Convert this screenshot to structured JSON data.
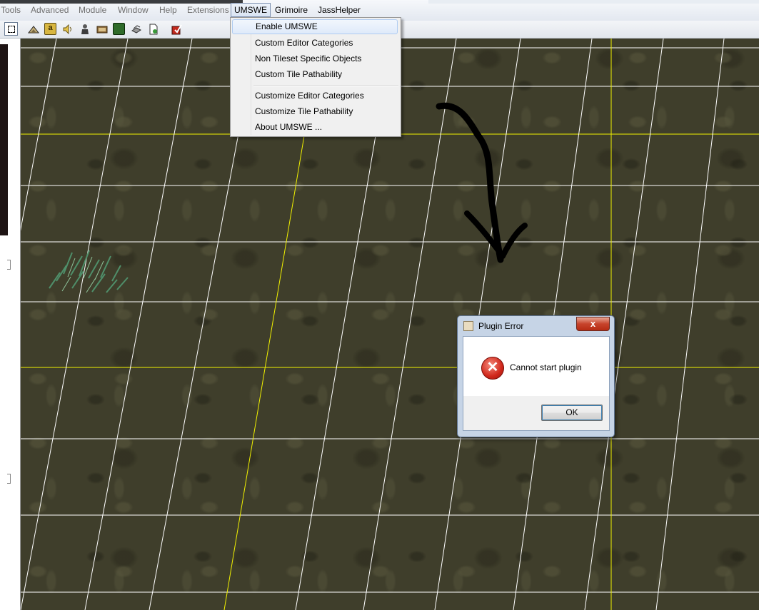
{
  "menubar": {
    "items": [
      {
        "label": "Tools",
        "state": "disabled"
      },
      {
        "label": "Advanced",
        "state": "disabled"
      },
      {
        "label": "Module",
        "state": "disabled"
      },
      {
        "label": "Window",
        "state": "disabled"
      },
      {
        "label": "Help",
        "state": "disabled"
      },
      {
        "label": "Extensions",
        "state": "disabled"
      },
      {
        "label": "UMSWE",
        "state": "open"
      },
      {
        "label": "Grimoire",
        "state": "active"
      },
      {
        "label": "JassHelper",
        "state": "active"
      }
    ]
  },
  "toolbar": {
    "buttons": [
      {
        "icon": "select-icon"
      },
      {
        "icon": "terrain-icon"
      },
      {
        "icon": "doodad-icon"
      },
      {
        "icon": "sound-icon"
      },
      {
        "icon": "unit-icon"
      },
      {
        "icon": "item-icon"
      },
      {
        "icon": "trigger-icon"
      },
      {
        "icon": "object-icon"
      },
      {
        "icon": "import-icon"
      },
      {
        "icon": "test-map-icon"
      }
    ]
  },
  "umswe_menu": {
    "items": [
      {
        "label": "Enable UMSWE",
        "highlighted": true
      },
      {
        "label": "Custom Editor Categories"
      },
      {
        "label": "Non Tileset Specific Objects"
      },
      {
        "label": "Custom Tile Pathability"
      },
      {
        "label": "Customize Editor Categories"
      },
      {
        "label": "Customize Tile Pathability"
      },
      {
        "label": "About UMSWE ..."
      }
    ]
  },
  "dialog": {
    "title": "Plugin Error",
    "close_label": "x",
    "message": "Cannot start plugin",
    "ok_label": "OK",
    "icon": "error-icon"
  },
  "annotation": {
    "icon": "hand-drawn-arrow-icon",
    "color": "#000000"
  },
  "colors": {
    "grid_major": "#f2f200",
    "grid_minor": "#ffffff",
    "terrain": "#3f3e2b"
  }
}
